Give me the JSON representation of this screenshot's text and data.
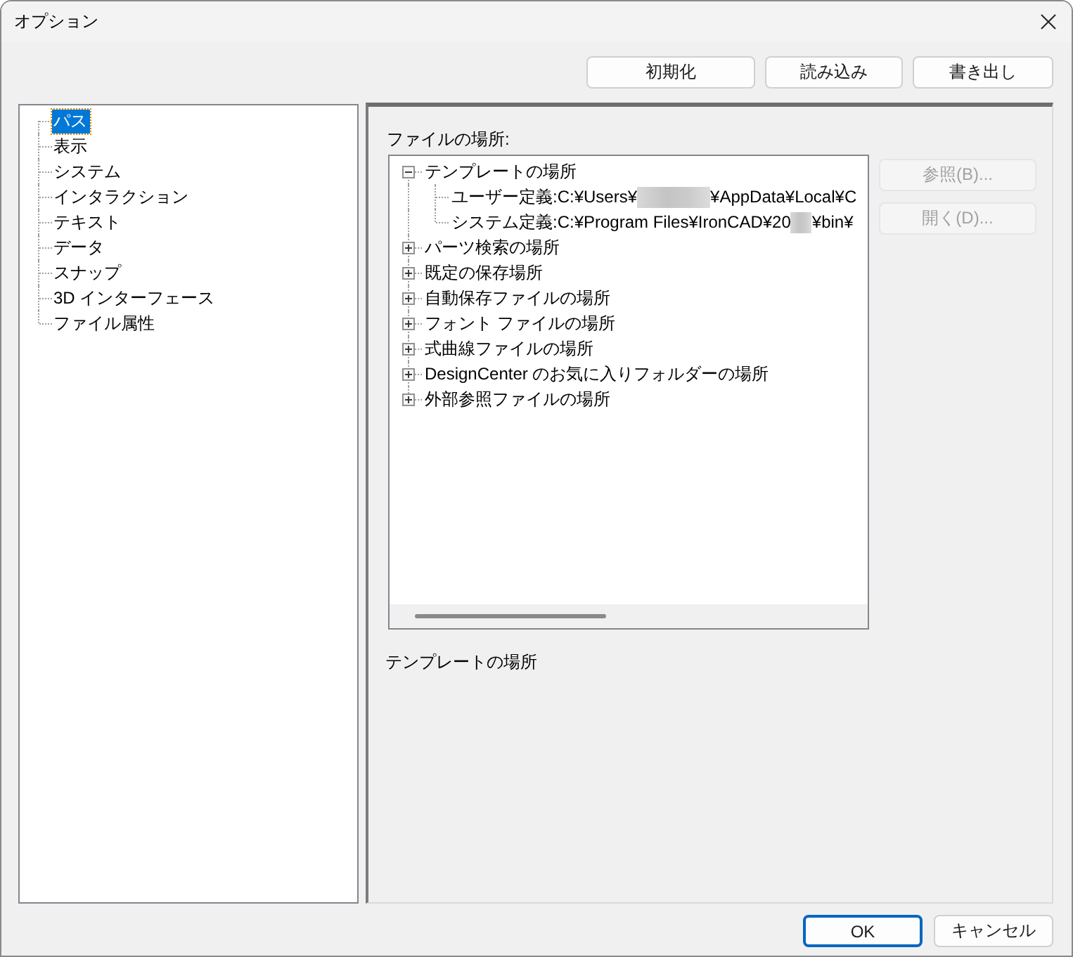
{
  "window": {
    "title": "オプション"
  },
  "toolbar_buttons": [
    "初期化",
    "読み込み",
    "書き出し"
  ],
  "categories": [
    {
      "label": "パス",
      "selected": true
    },
    {
      "label": "表示",
      "selected": false
    },
    {
      "label": "システム",
      "selected": false
    },
    {
      "label": "インタラクション",
      "selected": false
    },
    {
      "label": "テキスト",
      "selected": false
    },
    {
      "label": "データ",
      "selected": false
    },
    {
      "label": "スナップ",
      "selected": false
    },
    {
      "label": "3D インターフェース",
      "selected": false
    },
    {
      "label": "ファイル属性",
      "selected": false
    }
  ],
  "file_locations": {
    "label": "ファイルの場所:",
    "items": [
      {
        "label": "テンプレートの場所",
        "expanded": true,
        "children": [
          {
            "label": "ユーザー定義:C:¥Users¥",
            "label_after_redaction": "¥AppData¥Local¥C"
          },
          {
            "label": "システム定義:C:¥Program Files¥IronCAD¥20",
            "label_after_redaction": "¥bin¥"
          }
        ]
      },
      {
        "label": "パーツ検索の場所",
        "expanded": false
      },
      {
        "label": "既定の保存場所",
        "expanded": false
      },
      {
        "label": "自動保存ファイルの場所",
        "expanded": false
      },
      {
        "label": "フォント ファイルの場所",
        "expanded": false
      },
      {
        "label": "式曲線ファイルの場所",
        "expanded": false
      },
      {
        "label": "DesignCenter のお気に入りフォルダーの場所",
        "expanded": false
      },
      {
        "label": "外部参照ファイルの場所",
        "expanded": false
      }
    ]
  },
  "side_buttons": [
    {
      "label": "参照(B)...",
      "disabled": true
    },
    {
      "label": "開く(D)...",
      "disabled": true
    }
  ],
  "description": "テンプレートの場所",
  "dialog_buttons": [
    {
      "label": "OK",
      "default": true
    },
    {
      "label": "キャンセル",
      "default": false
    }
  ]
}
